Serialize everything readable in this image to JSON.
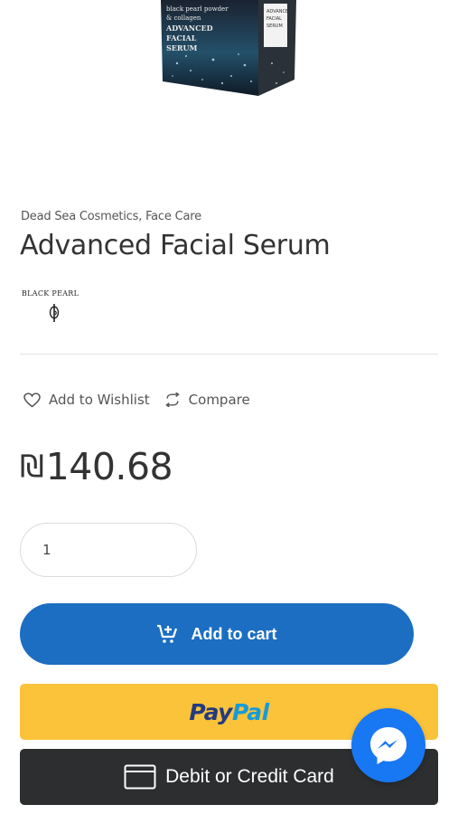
{
  "product": {
    "image_text_lines": [
      "black pearl powder",
      "& collagen",
      "ADVANCED",
      "FACIAL",
      "SERUM"
    ],
    "box_side_text": [
      "ADVANCED",
      "FACIAL",
      "SERUM"
    ],
    "categories": "Dead Sea Cosmetics, Face Care",
    "title": "Advanced Facial Serum",
    "brand": "BLACK PEARL"
  },
  "actions": {
    "wishlist_label": "Add to Wishlist",
    "compare_label": "Compare"
  },
  "price": {
    "currency_symbol": "₪",
    "amount": "140.68"
  },
  "quantity": {
    "value": "1"
  },
  "buttons": {
    "add_to_cart": "Add to cart",
    "paypal_pay": "Pay",
    "paypal_pal": "Pal",
    "card": "Debit or Credit Card"
  },
  "colors": {
    "add_to_cart_bg": "#1b6ec2",
    "paypal_bg": "#fbc33a",
    "card_bg": "#2c2e2f",
    "messenger_bg": "#1877f2"
  },
  "icons": [
    "heart-icon",
    "compare-icon",
    "cart-plus-icon",
    "card-icon",
    "messenger-icon"
  ]
}
